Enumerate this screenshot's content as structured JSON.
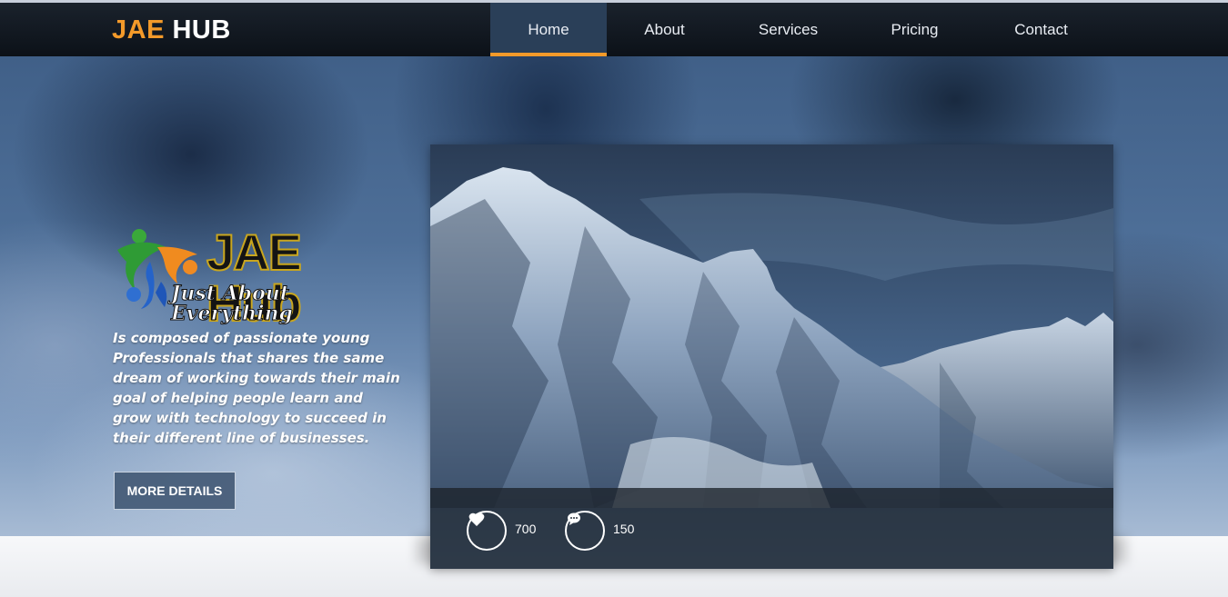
{
  "brand": {
    "part1": "JAE",
    "part2": "HUB"
  },
  "nav": {
    "items": [
      {
        "label": "Home",
        "active": true
      },
      {
        "label": "About",
        "active": false
      },
      {
        "label": "Services",
        "active": false
      },
      {
        "label": "Pricing",
        "active": false
      },
      {
        "label": "Contact",
        "active": false
      }
    ]
  },
  "hero": {
    "logo_word": "JAE Hub",
    "logo_tagline": "Just About Everything",
    "intro": "Is composed of passionate young Professionals that shares the same dream of working towards their main goal of helping people learn and grow with technology to succeed in their different line of businesses.",
    "more_button": "MORE DETAILS"
  },
  "card": {
    "likes": "700",
    "comments": "150"
  },
  "colors": {
    "accent": "#f39a2a",
    "navbar": "#0c1118",
    "active_nav": "#2a3f58"
  },
  "icons": [
    "heart-icon",
    "comment-icon",
    "people-logo-icon"
  ]
}
